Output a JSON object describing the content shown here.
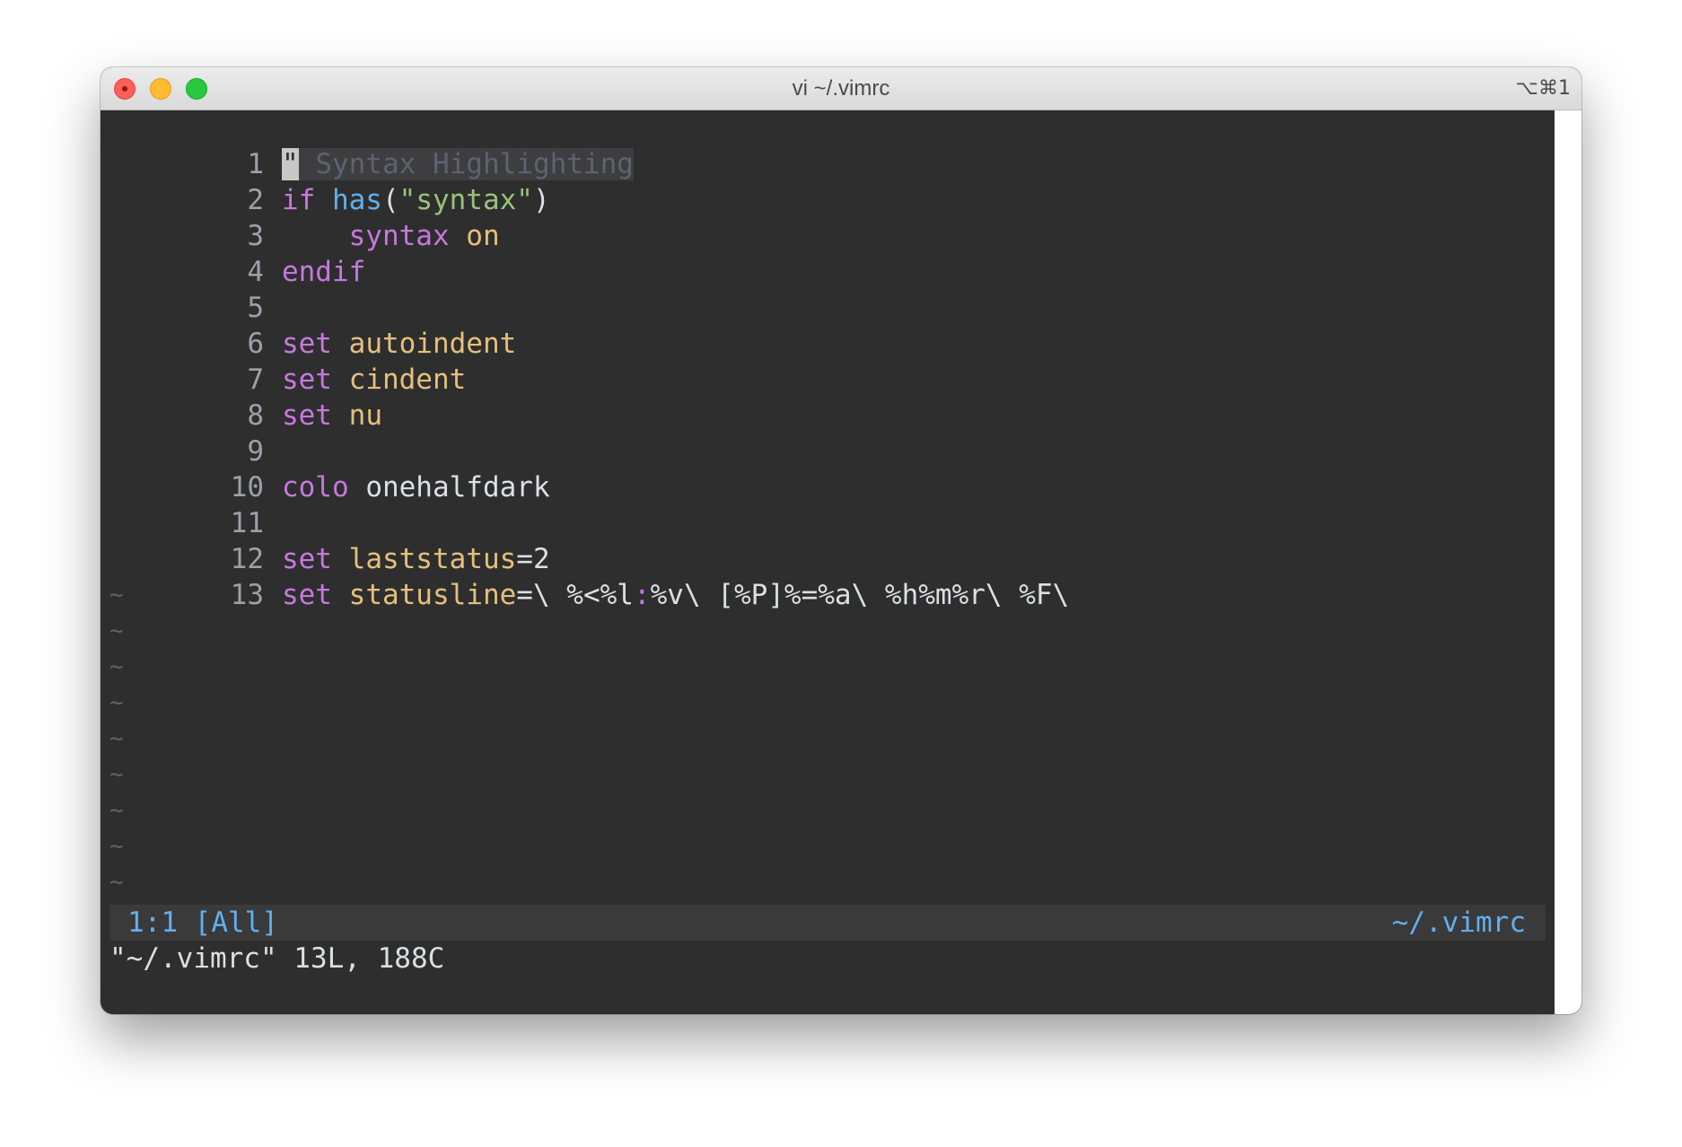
{
  "window": {
    "title": "vi ~/.vimrc",
    "shortcut": "⌥⌘1"
  },
  "editor": {
    "lines": [
      {
        "num": "1",
        "cursor_char": "\"",
        "rest": " Syntax Highlighting"
      },
      {
        "num": "2",
        "t1": "if",
        "t2": "has",
        "t3": "(",
        "t4": "\"syntax\"",
        "t5": ")"
      },
      {
        "num": "3",
        "t1": "syntax",
        "t2": "on"
      },
      {
        "num": "4",
        "t1": "endif"
      },
      {
        "num": "5"
      },
      {
        "num": "6",
        "t1": "set",
        "t2": "autoindent"
      },
      {
        "num": "7",
        "t1": "set",
        "t2": "cindent"
      },
      {
        "num": "8",
        "t1": "set",
        "t2": "nu"
      },
      {
        "num": "9"
      },
      {
        "num": "10",
        "t1": "colo",
        "t2": "onehalfdark"
      },
      {
        "num": "11"
      },
      {
        "num": "12",
        "t1": "set",
        "t2": "laststatus",
        "t3": "=2"
      },
      {
        "num": "13",
        "t1": "set",
        "t2": "statusline",
        "t3": "=\\ %<%l",
        "t4": ":",
        "t5": "%v\\ [%P]%=%a\\ %h%m%r\\ %F\\"
      }
    ],
    "tilde": "~"
  },
  "statusline": {
    "left": "1:1 [All]",
    "right": "~/.vimrc"
  },
  "message": "\"~/.vimrc\" 13L, 188C",
  "colors": {
    "background": "#2e2e2f",
    "keyword": "#c678dd",
    "function": "#61afef",
    "string": "#98c379",
    "option": "#e5c07b",
    "comment": "#5c6370"
  }
}
